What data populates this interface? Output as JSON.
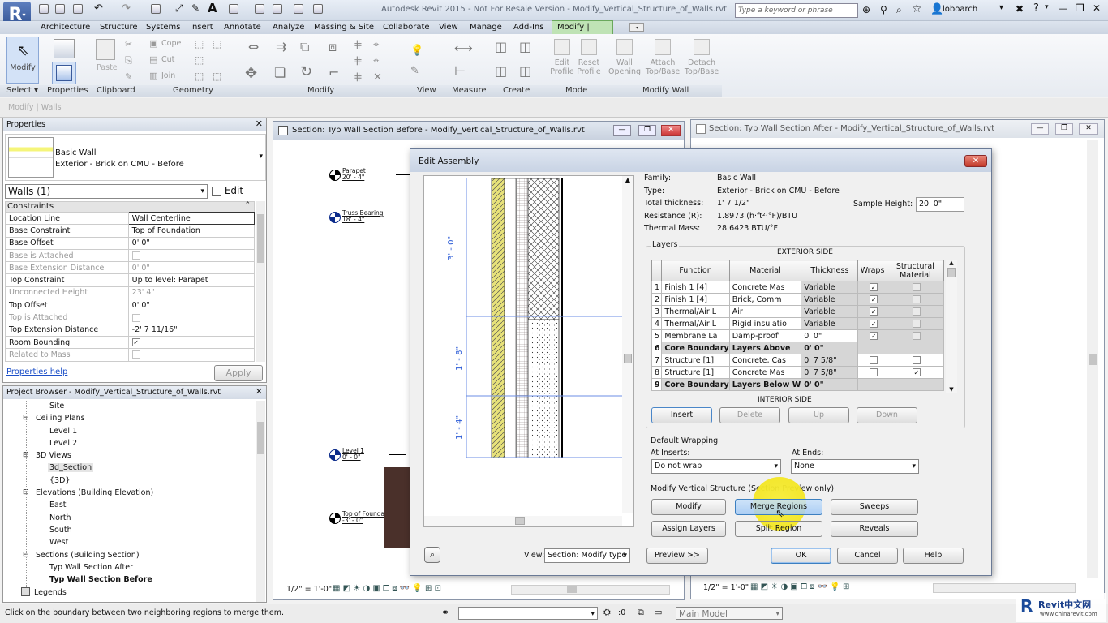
{
  "app": {
    "title": "Autodesk Revit 2015 - Not For Resale Version -   Modify_Vertical_Structure_of_Walls.rvt",
    "search_placeholder": "Type a keyword or phrase",
    "user": "loboarch"
  },
  "ribbon_tabs": [
    "Architecture",
    "Structure",
    "Systems",
    "Insert",
    "Annotate",
    "Analyze",
    "Massing & Site",
    "Collaborate",
    "View",
    "Manage",
    "Add-Ins",
    "Modify | Walls"
  ],
  "ribbon": {
    "modify": "Modify",
    "paste": "Paste",
    "cope": "Cope",
    "cut": "Cut",
    "join": "Join",
    "edit_profile": "Edit Profile",
    "reset_profile": "Reset Profile",
    "wall_opening": "Wall Opening",
    "attach": "Attach Top/Base",
    "detach": "Detach Top/Base",
    "panels": [
      "Select",
      "Properties",
      "Clipboard",
      "Geometry",
      "Modify",
      "View",
      "Measure",
      "Create",
      "Mode",
      "Modify Wall"
    ]
  },
  "context_bar": "Modify | Walls",
  "properties": {
    "title": "Properties",
    "family": "Basic Wall",
    "type": "Exterior - Brick on CMU - Before",
    "selector": "Walls (1)",
    "edit_type": "Edit Type",
    "group": "Constraints",
    "rows": [
      {
        "name": "Location Line",
        "value": "Wall Centerline",
        "dim": false
      },
      {
        "name": "Base Constraint",
        "value": "Top of Foundation",
        "dim": false
      },
      {
        "name": "Base Offset",
        "value": "0' 0\"",
        "dim": false
      },
      {
        "name": "Base is Attached",
        "value": "",
        "dim": true
      },
      {
        "name": "Base Extension Distance",
        "value": "0' 0\"",
        "dim": true
      },
      {
        "name": "Top Constraint",
        "value": "Up to level: Parapet",
        "dim": false
      },
      {
        "name": "Unconnected Height",
        "value": "23' 4\"",
        "dim": true
      },
      {
        "name": "Top Offset",
        "value": "0' 0\"",
        "dim": false
      },
      {
        "name": "Top is Attached",
        "value": "",
        "dim": true
      },
      {
        "name": "Top Extension Distance",
        "value": "-2' 7 11/16\"",
        "dim": false
      },
      {
        "name": "Room Bounding",
        "value": "✓",
        "dim": false
      },
      {
        "name": "Related to Mass",
        "value": "",
        "dim": true
      }
    ],
    "help": "Properties help",
    "apply": "Apply"
  },
  "project_browser": {
    "title": "Project Browser - Modify_Vertical_Structure_of_Walls.rvt",
    "items": [
      "Site",
      "Ceiling Plans",
      "Level 1",
      "Level 2",
      "3D Views",
      "3d_Section",
      "{3D}",
      "Elevations (Building Elevation)",
      "East",
      "North",
      "South",
      "West",
      "Sections (Building Section)",
      "Typ Wall Section After",
      "Typ Wall Section Before",
      "Legends"
    ]
  },
  "view1": {
    "title": "Section: Typ Wall Section Before - Modify_Vertical_Structure_of_Walls.rvt",
    "scale": "1/2\" = 1'-0\""
  },
  "view2": {
    "title": "Section: Typ Wall Section After - Modify_Vertical_Structure_of_Walls.rvt",
    "scale": "1/2\" = 1'-0\""
  },
  "levels": [
    {
      "name": "Parapet",
      "elev": "20' - 4\""
    },
    {
      "name": "Truss Bearing",
      "elev": "18' - 4\""
    },
    {
      "name": "Level 1",
      "elev": "0' - 0\""
    },
    {
      "name": "Top of Foundation",
      "elev": "-3' - 0\""
    }
  ],
  "dialog": {
    "title": "Edit Assembly",
    "info_labels": [
      "Family:",
      "Type:",
      "Total thickness:",
      "Resistance (R):",
      "Thermal Mass:"
    ],
    "info_values": [
      "Basic Wall",
      "Exterior - Brick on CMU - Before",
      "1'  7 1/2\"",
      "1.8973 (h·ft²·°F)/BTU",
      "28.6423 BTU/°F"
    ],
    "sample_height_label": "Sample Height:",
    "sample_height": "20'  0\"",
    "layers_label": "Layers",
    "exterior": "EXTERIOR SIDE",
    "interior": "INTERIOR SIDE",
    "headers": [
      "",
      "Function",
      "Material",
      "Thickness",
      "Wraps",
      "Structural Material"
    ],
    "layers": [
      {
        "n": "1",
        "f": "Finish 1 [4]",
        "m": "Concrete Mas",
        "t": "Variable",
        "w": "✓",
        "s": ""
      },
      {
        "n": "2",
        "f": "Finish 1 [4]",
        "m": "Brick, Comm",
        "t": "Variable",
        "w": "✓",
        "s": ""
      },
      {
        "n": "3",
        "f": "Thermal/Air L",
        "m": "Air",
        "t": "Variable",
        "w": "✓",
        "s": ""
      },
      {
        "n": "4",
        "f": "Thermal/Air L",
        "m": "Rigid insulatio",
        "t": "Variable",
        "w": "✓",
        "s": ""
      },
      {
        "n": "5",
        "f": "Membrane La",
        "m": "Damp-proofi",
        "t": "0' 0\"",
        "w": "✓",
        "s": ""
      },
      {
        "n": "6",
        "f": "Core Boundary",
        "m": "Layers Above",
        "t": "0'  0\"",
        "w": "",
        "s": ""
      },
      {
        "n": "7",
        "f": "Structure [1]",
        "m": "Concrete, Cas",
        "t": "0' 7 5/8\"",
        "w": "",
        "s": ""
      },
      {
        "n": "8",
        "f": "Structure [1]",
        "m": "Concrete Mas",
        "t": "0' 7 5/8\"",
        "w": "",
        "s": "✓"
      },
      {
        "n": "9",
        "f": "Core Boundary",
        "m": "Layers Below W",
        "t": "0'  0\"",
        "w": "",
        "s": ""
      }
    ],
    "insert": "Insert",
    "delete": "Delete",
    "up": "Up",
    "down": "Down",
    "default_wrapping": "Default Wrapping",
    "at_inserts": "At Inserts:",
    "at_inserts_val": "Do not wrap",
    "at_ends": "At Ends:",
    "at_ends_val": "None",
    "mvs": "Modify Vertical Structure (Section Preview only)",
    "modify": "Modify",
    "merge": "Merge Regions",
    "sweeps": "Sweeps",
    "assign": "Assign Layers",
    "split": "Split Region",
    "reveals": "Reveals",
    "view_label": "View:",
    "view_val": "Section: Modify type",
    "preview": "Preview >>",
    "ok": "OK",
    "cancel": "Cancel",
    "help": "Help",
    "dims": [
      "3' - 0\"",
      "1' - 8\"",
      "1' - 4\""
    ]
  },
  "status": {
    "hint": "Click on the boundary between two neighboring regions to merge them.",
    "zero": ":0",
    "model": "Main Model"
  },
  "watermark": {
    "brand": "Revit中文网",
    "url": "www.chinarevit.com"
  }
}
